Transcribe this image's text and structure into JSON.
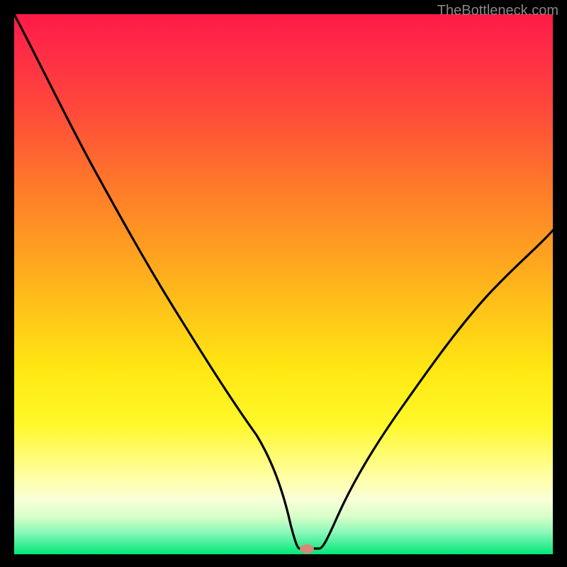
{
  "watermark": "TheBottleneck.com",
  "chart_data": {
    "type": "line",
    "title": "",
    "xlabel": "",
    "ylabel": "",
    "xlim": [
      0,
      100
    ],
    "ylim": [
      0,
      100
    ],
    "background": "vertical-gradient-red-to-green",
    "series": [
      {
        "name": "bottleneck-curve",
        "x": [
          0,
          5,
          10,
          15,
          20,
          25,
          30,
          35,
          40,
          45,
          50,
          53,
          55,
          57,
          60,
          65,
          70,
          75,
          80,
          85,
          90,
          95,
          100
        ],
        "y": [
          100,
          90,
          80,
          71,
          63,
          54,
          46,
          38,
          30,
          22,
          12,
          3,
          1,
          1,
          3,
          10,
          18,
          27,
          36,
          44,
          51,
          56,
          60
        ]
      }
    ],
    "marker": {
      "x": 55,
      "y": 1,
      "color": "#d88878"
    },
    "grid": false,
    "legend": "none"
  },
  "colors": {
    "gradient_top": "#ff1a47",
    "gradient_mid": "#fff82a",
    "gradient_bottom": "#00e878",
    "curve": "#000000",
    "frame": "#000000",
    "marker": "#d88878",
    "watermark": "#888888"
  }
}
